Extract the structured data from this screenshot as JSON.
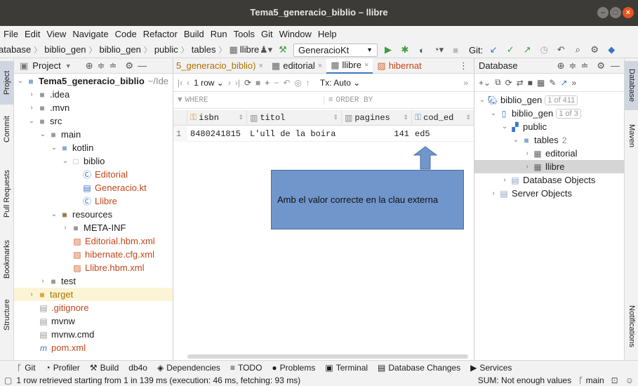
{
  "window": {
    "title": "Tema5_generacio_biblio – llibre"
  },
  "menu": [
    "File",
    "Edit",
    "View",
    "Navigate",
    "Code",
    "Refactor",
    "Build",
    "Run",
    "Tools",
    "Git",
    "Window",
    "Help"
  ],
  "breadcrumb": [
    "atabase",
    "biblio_gen",
    "biblio_gen",
    "public",
    "tables",
    "llibre"
  ],
  "toolbar": {
    "run_config": "GeneracioKt",
    "git_label": "Git:"
  },
  "left_tabs": [
    "Project",
    "Commit",
    "Pull Requests",
    "Bookmarks",
    "Structure"
  ],
  "right_tabs": [
    "Database",
    "Maven",
    "Notifications"
  ],
  "project": {
    "header": "Project",
    "root_name": "Tema5_generacio_biblio",
    "root_path": "~/Ide",
    "items": [
      {
        "label": ".idea"
      },
      {
        "label": ".mvn"
      },
      {
        "label": "src"
      },
      {
        "label": "main"
      },
      {
        "label": "kotlin"
      },
      {
        "label": "biblio"
      },
      {
        "label": "Editorial"
      },
      {
        "label": "Generacio.kt"
      },
      {
        "label": "Llibre"
      },
      {
        "label": "resources"
      },
      {
        "label": "META-INF"
      },
      {
        "label": "Editorial.hbm.xml"
      },
      {
        "label": "hibernate.cfg.xml"
      },
      {
        "label": "Llibre.hbm.xml"
      },
      {
        "label": "test"
      },
      {
        "label": "target"
      },
      {
        "label": ".gitignore"
      },
      {
        "label": "mvnw"
      },
      {
        "label": "mvnw.cmd"
      },
      {
        "label": "pom.xml"
      }
    ]
  },
  "editor": {
    "tabs": [
      "5_generacio_biblio)",
      "editorial",
      "llibre",
      "hibernat"
    ],
    "row_selector": "1 row",
    "tx": "Tx: Auto",
    "where": "WHERE",
    "order_by": "ORDER BY",
    "columns": [
      "isbn",
      "titol",
      "pagines",
      "cod_ed"
    ],
    "rows": [
      {
        "num": "1",
        "isbn": "8480241815",
        "titol": "L'ull de la boira",
        "pagines": "141",
        "cod_ed": "ed5"
      }
    ]
  },
  "callout": {
    "text": "Amb el valor correcte en la clau externa"
  },
  "database": {
    "header": "Database",
    "items": [
      {
        "label": "biblio_gen",
        "badge": "1 of 411"
      },
      {
        "label": "biblio_gen",
        "badge": "1 of 3"
      },
      {
        "label": "public"
      },
      {
        "label": "tables",
        "count": "2"
      },
      {
        "label": "editorial"
      },
      {
        "label": "llibre"
      },
      {
        "label": "Database Objects"
      },
      {
        "label": "Server Objects"
      }
    ]
  },
  "bottom_tools": [
    "Git",
    "Profiler",
    "Build",
    "db4o",
    "Dependencies",
    "TODO",
    "Problems",
    "Terminal",
    "Database Changes",
    "Services"
  ],
  "status": {
    "message": "1 row retrieved starting from 1 in 139 ms (execution: 46 ms, fetching: 93 ms)",
    "sum": "SUM: Not enough values",
    "branch": "main"
  }
}
